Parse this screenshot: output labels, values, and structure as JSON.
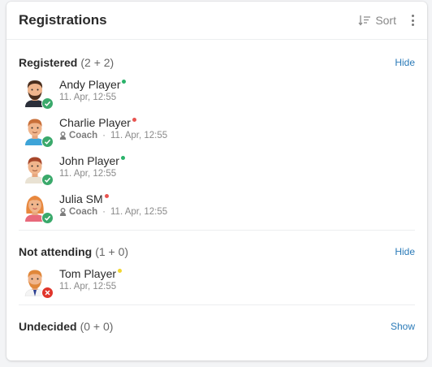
{
  "header": {
    "title": "Registrations",
    "sort_label": "Sort"
  },
  "sections": {
    "registered": {
      "title": "Registered",
      "count": "(2 + 2)",
      "toggle": "Hide",
      "players": [
        {
          "name": "Andy Player",
          "date": "11. Apr, 12:55",
          "role": "",
          "dot": "#2ab36a"
        },
        {
          "name": "Charlie Player",
          "date": "11. Apr, 12:55",
          "role": "Coach",
          "dot": "#e85450"
        },
        {
          "name": "John Player",
          "date": "11. Apr, 12:55",
          "role": "",
          "dot": "#2ab36a"
        },
        {
          "name": "Julia SM",
          "date": "11. Apr, 12:55",
          "role": "Coach",
          "dot": "#e85450"
        }
      ]
    },
    "not_attending": {
      "title": "Not attending",
      "count": "(1 + 0)",
      "toggle": "Hide",
      "players": [
        {
          "name": "Tom Player",
          "date": "11. Apr, 12:55",
          "role": "",
          "dot": "#f2d630"
        }
      ]
    },
    "undecided": {
      "title": "Undecided",
      "count": "(0 + 0)",
      "toggle": "Show"
    }
  },
  "icons": {
    "sort": "sort-icon",
    "more": "more-vertical-icon",
    "coach": "coach-icon",
    "registered_badge": "checkmark-icon",
    "declined_badge": "x-icon"
  },
  "colors": {
    "accent_link": "#2a7ab8",
    "registered_badge": "#3aa96b",
    "declined_badge": "#e0352b"
  }
}
